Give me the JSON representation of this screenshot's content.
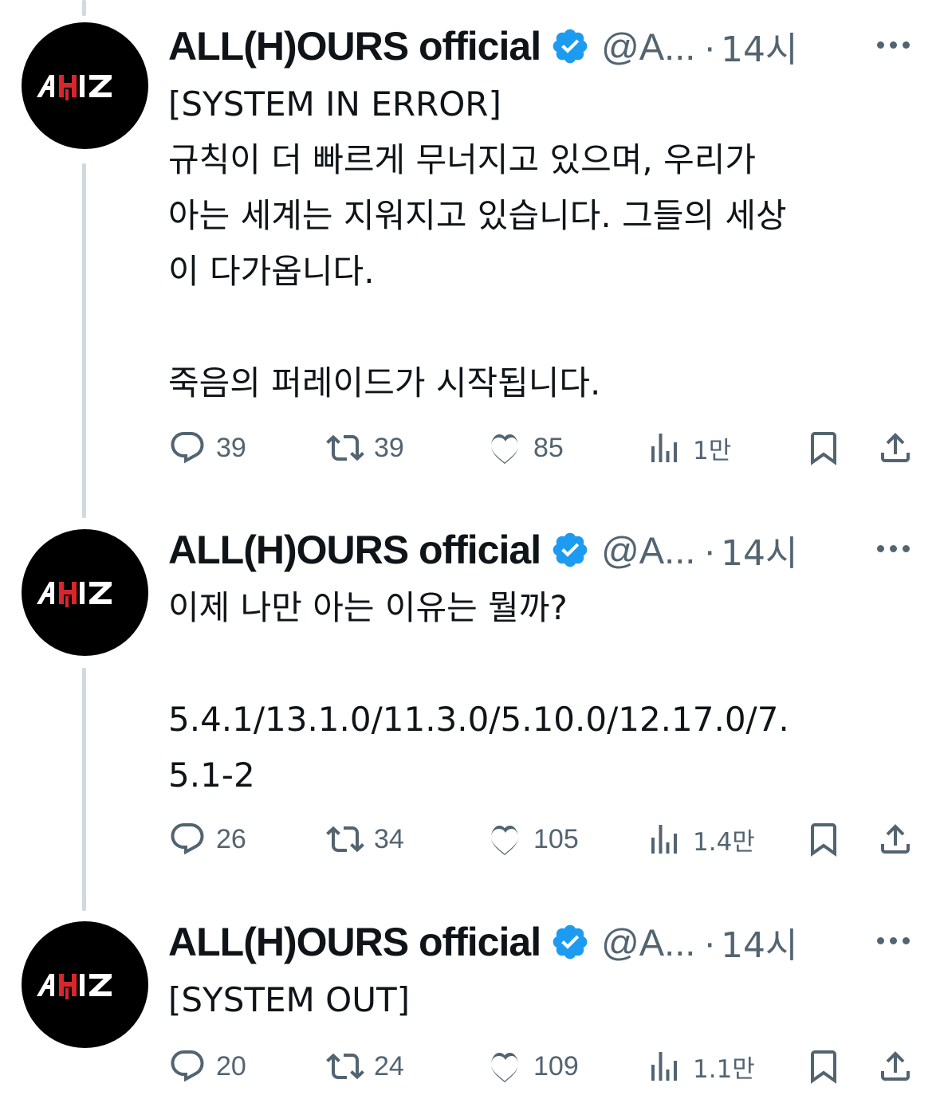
{
  "tweets": [
    {
      "name": "ALL(H)OURS official",
      "handle": "@A...",
      "separator": "·",
      "time": "14시",
      "text": "[SYSTEM IN ERROR]\n규칙이 더 빠르게 무너지고 있으며, 우리가\n아는 세계는 지워지고 있습니다. 그들의 세상\n이 다가옵니다.\n\n죽음의 퍼레이드가 시작됩니다.",
      "replies": "39",
      "reposts": "39",
      "likes": "85",
      "views": "1만"
    },
    {
      "name": "ALL(H)OURS official",
      "handle": "@A...",
      "separator": "·",
      "time": "14시",
      "text": "이제 나만 아는 이유는 뭘까?\n\n5.4.1/13.1.0/11.3.0/5.10.0/12.17.0/7.\n5.1-2",
      "replies": "26",
      "reposts": "34",
      "likes": "105",
      "views": "1.4만"
    },
    {
      "name": "ALL(H)OURS official",
      "handle": "@A...",
      "separator": "·",
      "time": "14시",
      "text": "[SYSTEM OUT]",
      "replies": "20",
      "reposts": "24",
      "likes": "109",
      "views": "1.1만"
    }
  ],
  "colors": {
    "verified": "#1d9bf0",
    "muted": "#536471",
    "thread_line": "#cfd9de",
    "avatar_bg": "#000000",
    "logo_red": "#d8262c"
  },
  "icons": [
    "verified-badge-icon",
    "more-icon",
    "reply-icon",
    "repost-icon",
    "like-icon",
    "views-icon",
    "bookmark-icon",
    "share-icon"
  ]
}
